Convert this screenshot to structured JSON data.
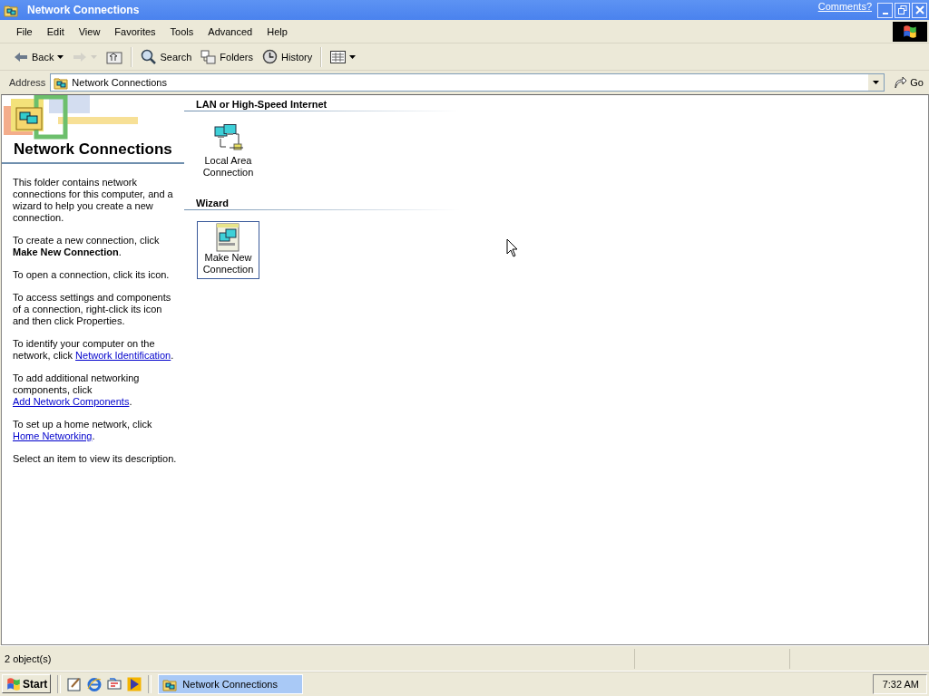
{
  "window": {
    "title": "Network Connections",
    "comments_link": "Comments?"
  },
  "menu": [
    "File",
    "Edit",
    "View",
    "Favorites",
    "Tools",
    "Advanced",
    "Help"
  ],
  "toolbar": {
    "buttons": [
      {
        "kind": "back",
        "label": "Back",
        "disabled": false
      },
      {
        "kind": "forward",
        "disabled": true
      },
      {
        "kind": "up",
        "disabled": false
      },
      {
        "kind": "search",
        "label": "Search",
        "disabled": false
      },
      {
        "kind": "folders",
        "label": "Folders",
        "disabled": false
      },
      {
        "kind": "history",
        "label": "History",
        "disabled": false
      },
      {
        "kind": "views",
        "disabled": false
      }
    ]
  },
  "address": {
    "label": "Address",
    "value": "Network Connections",
    "go": "Go"
  },
  "sidebar": {
    "title": "Network Connections",
    "paragraphs": [
      [
        {
          "kind": "text",
          "text": "This folder contains network connections for this computer, and a wizard to help you create a new connection."
        }
      ],
      [
        {
          "kind": "text",
          "text": "To create a new connection, click **Make New Connection**."
        }
      ],
      [
        {
          "kind": "text",
          "text": "To open a connection, click its icon."
        }
      ],
      [
        {
          "kind": "text",
          "text": "To access settings and components of a connection, right-click its icon and then click Properties."
        }
      ],
      [
        {
          "kind": "text",
          "text": "To identify your computer on the network, click "
        },
        {
          "kind": "link",
          "text": "Network Identification"
        },
        {
          "kind": "text",
          "text": "."
        }
      ],
      [
        {
          "kind": "text",
          "text": "To add additional networking components, click "
        },
        {
          "kind": "link",
          "text": "Add Network Components"
        },
        {
          "kind": "text",
          "text": "."
        }
      ],
      [
        {
          "kind": "text",
          "text": "To set up a home network, click "
        },
        {
          "kind": "link",
          "text": "Home Networking"
        },
        {
          "kind": "text",
          "text": "."
        }
      ],
      [
        {
          "kind": "text",
          "text": "Select an item to view its description."
        }
      ]
    ]
  },
  "groups": [
    {
      "title": "LAN or High-Speed Internet",
      "items": [
        {
          "kind": "lan",
          "label": "Local Area Connection",
          "selected": false
        }
      ]
    },
    {
      "title": "Wizard",
      "items": [
        {
          "kind": "wizard",
          "label": "Make New Connection",
          "selected": true
        }
      ]
    }
  ],
  "status_bar": {
    "text": "2 object(s)"
  },
  "taskbar": {
    "start": "Start",
    "quick_launch": [
      {
        "kind": "desktop"
      },
      {
        "kind": "browser"
      },
      {
        "kind": "channels"
      },
      {
        "kind": "media"
      }
    ],
    "tasks": [
      {
        "label": "Network Connections",
        "selected": true
      }
    ],
    "clock": "7:32 AM"
  }
}
